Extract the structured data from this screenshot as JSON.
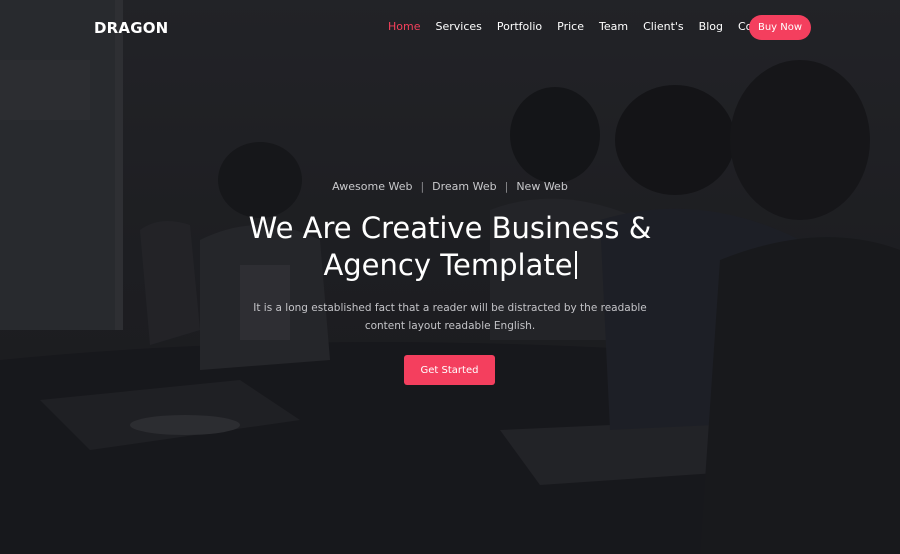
{
  "brand": {
    "name": "DRAGON"
  },
  "nav": {
    "items": [
      {
        "label": "Home",
        "active": true
      },
      {
        "label": "Services",
        "active": false
      },
      {
        "label": "Portfolio",
        "active": false
      },
      {
        "label": "Price",
        "active": false
      },
      {
        "label": "Team",
        "active": false
      },
      {
        "label": "Client's",
        "active": false
      },
      {
        "label": "Blog",
        "active": false
      },
      {
        "label": "Contact",
        "active": false
      }
    ],
    "cta_label": "Buy Now"
  },
  "hero": {
    "taglines": [
      "Awesome Web",
      "Dream Web",
      "New Web"
    ],
    "separator": "|",
    "headline_line1": "We Are Creative Business &",
    "headline_line2": "Agency Template",
    "description_line1": "It is a long established fact that a reader will be distracted by the readable",
    "description_line2": "content layout readable English.",
    "button_label": "Get Started"
  },
  "colors": {
    "accent": "#f43f5e",
    "background": "#1c1d21",
    "text": "#ffffff"
  }
}
